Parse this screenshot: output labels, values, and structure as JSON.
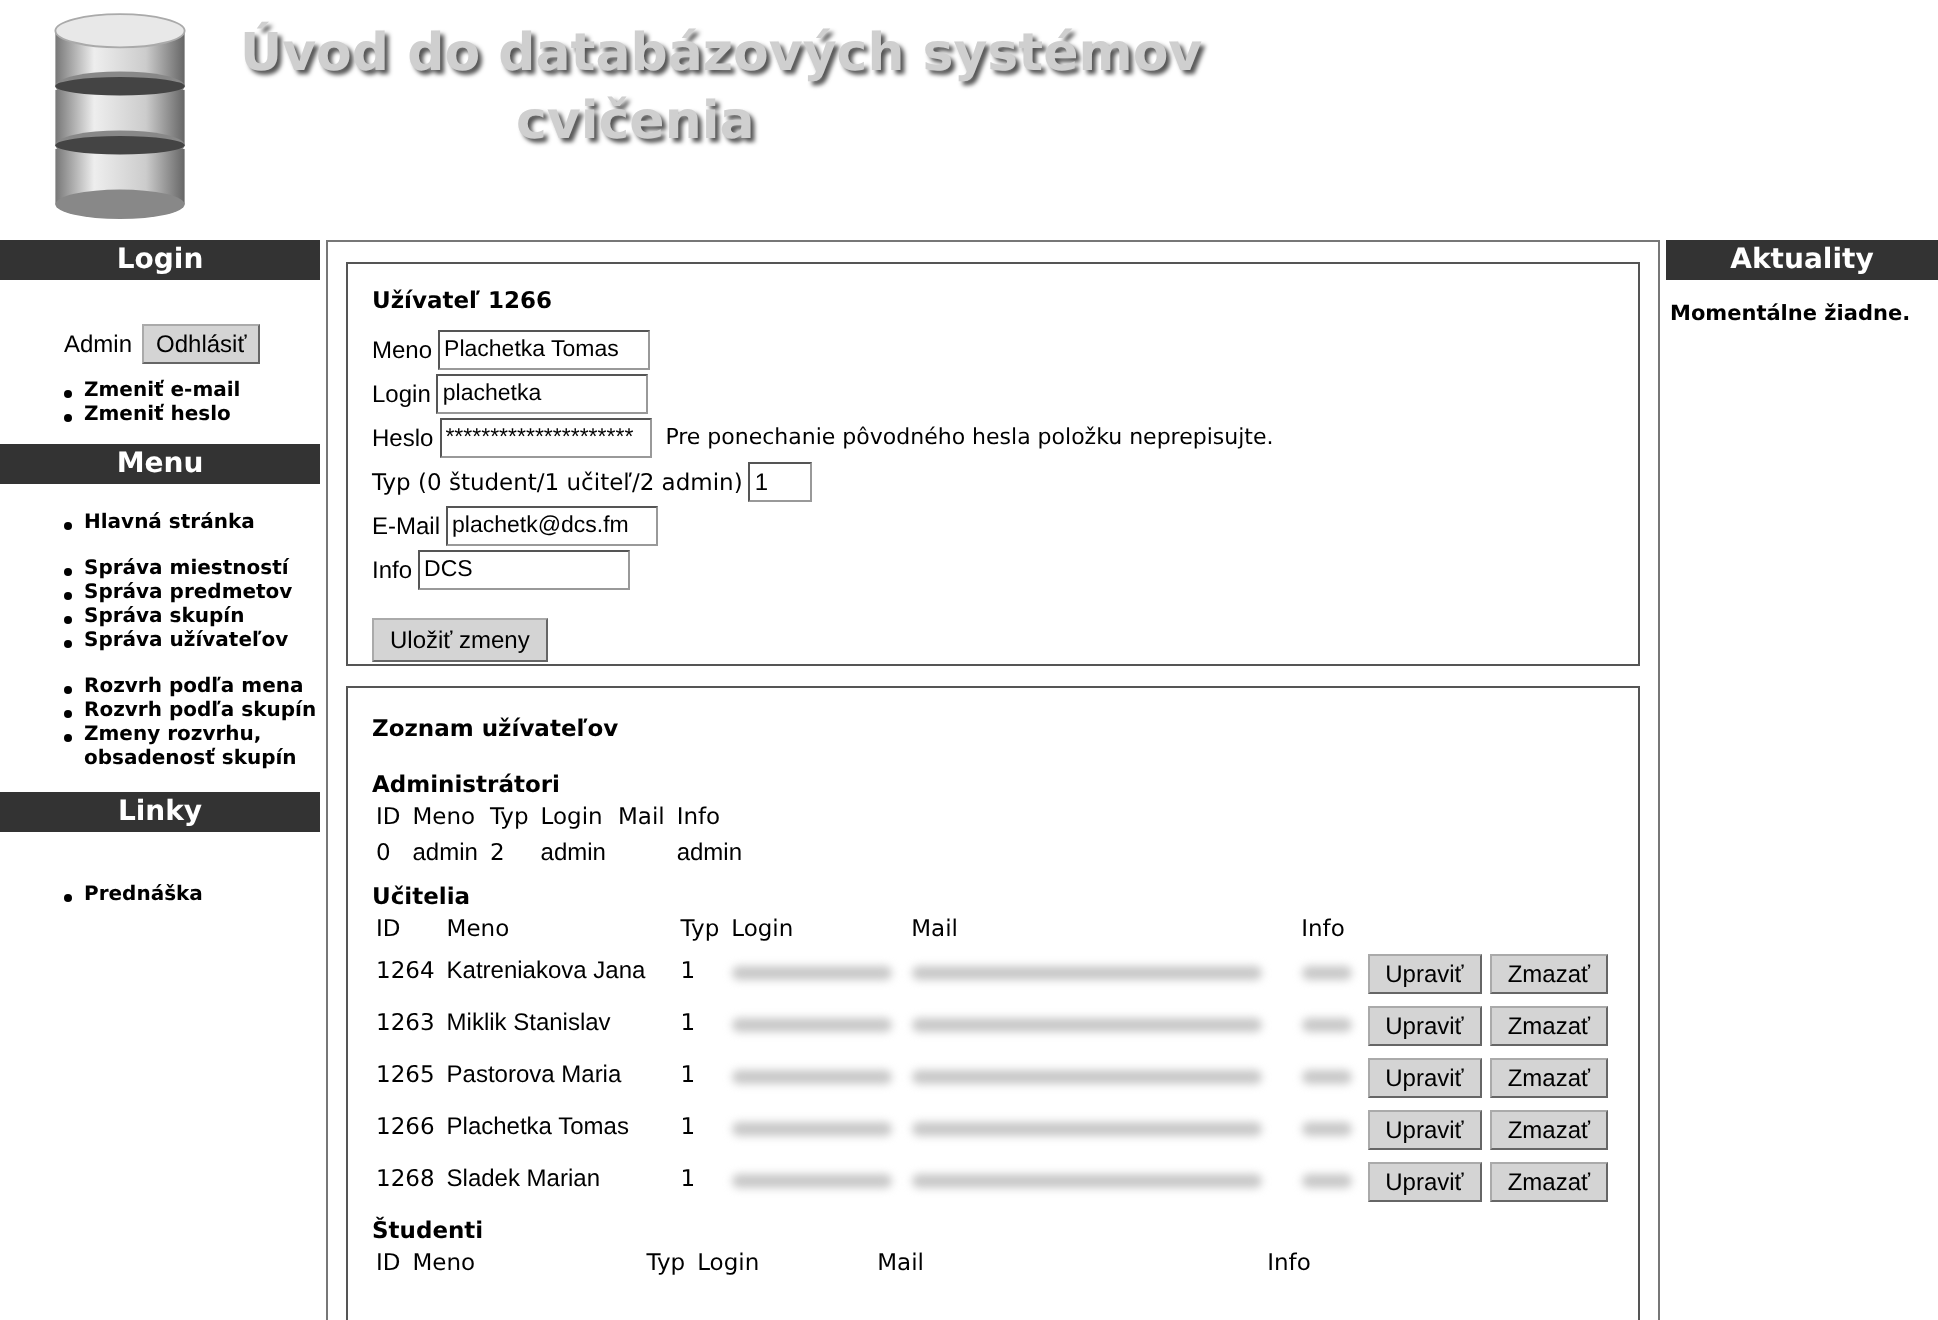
{
  "header": {
    "title": "Úvod do databázových systémov",
    "subtitle": "cvičenia"
  },
  "login": {
    "heading": "Login",
    "user": "Admin",
    "logout": "Odhlásiť",
    "links": [
      "Zmeniť e-mail",
      "Zmeniť heslo"
    ]
  },
  "menu": {
    "heading": "Menu",
    "groups": [
      [
        "Hlavná stránka"
      ],
      [
        "Správa miestností",
        "Správa predmetov",
        "Správa skupín",
        "Správa užívateľov"
      ],
      [
        "Rozvrh podľa mena",
        "Rozvrh podľa skupín",
        "Zmeny rozvrhu, obsadenosť skupín"
      ]
    ]
  },
  "links": {
    "heading": "Linky",
    "items": [
      "Prednáška"
    ]
  },
  "news": {
    "heading": "Aktuality",
    "text": "Momentálne žiadne."
  },
  "user_form": {
    "title": "Užívateľ 1266",
    "fields": [
      {
        "label": "Meno",
        "value": "Plachetka Tomas",
        "kind": "text"
      },
      {
        "label": "Login",
        "value": "plachetka",
        "kind": "text"
      },
      {
        "label": "Heslo",
        "value": "*********************",
        "kind": "text",
        "hint": "Pre ponechanie pôvodného hesla položku neprepisujte."
      },
      {
        "label": "Typ (0 študent/1 učiteľ/2 admin)",
        "value": "1",
        "kind": "short"
      },
      {
        "label": "E-Mail",
        "value": "plachetk@dcs.fm",
        "kind": "text"
      },
      {
        "label": "Info",
        "value": "DCS",
        "kind": "text"
      }
    ],
    "save": "Uložiť zmeny"
  },
  "user_list": {
    "title": "Zoznam užívateľov",
    "tables": [
      {
        "title": "Administrátori",
        "blurred": false,
        "columns": [
          "ID",
          "Meno",
          "Typ",
          "Login",
          "Mail",
          "Info"
        ],
        "rows": [
          {
            "cells": [
              "0",
              "admin",
              "2",
              "admin",
              null,
              "admin"
            ]
          }
        ]
      },
      {
        "title": "Učitelia",
        "blurred": true,
        "columns": [
          "ID",
          "Meno",
          "Typ",
          "Login",
          "Mail",
          "Info"
        ],
        "rows": [
          {
            "cells": [
              "1264",
              "Katreniakova Jana",
              "1",
              null,
              null,
              null
            ],
            "actions": [
              "Upraviť",
              "Zmazať"
            ]
          },
          {
            "cells": [
              "1263",
              "Miklik Stanislav",
              "1",
              null,
              null,
              null
            ],
            "actions": [
              "Upraviť",
              "Zmazať"
            ]
          },
          {
            "cells": [
              "1265",
              "Pastorova Maria",
              "1",
              null,
              null,
              null
            ],
            "actions": [
              "Upraviť",
              "Zmazať"
            ]
          },
          {
            "cells": [
              "1266",
              "Plachetka Tomas",
              "1",
              null,
              null,
              null
            ],
            "actions": [
              "Upraviť",
              "Zmazať"
            ]
          },
          {
            "cells": [
              "1268",
              "Sladek Marian",
              "1",
              null,
              null,
              null
            ],
            "actions": [
              "Upraviť",
              "Zmazať"
            ]
          }
        ]
      },
      {
        "title": "Študenti",
        "blurred": false,
        "columns": [
          "ID",
          "Meno",
          "Typ",
          "Login",
          "Mail",
          "Info"
        ]
      }
    ]
  }
}
